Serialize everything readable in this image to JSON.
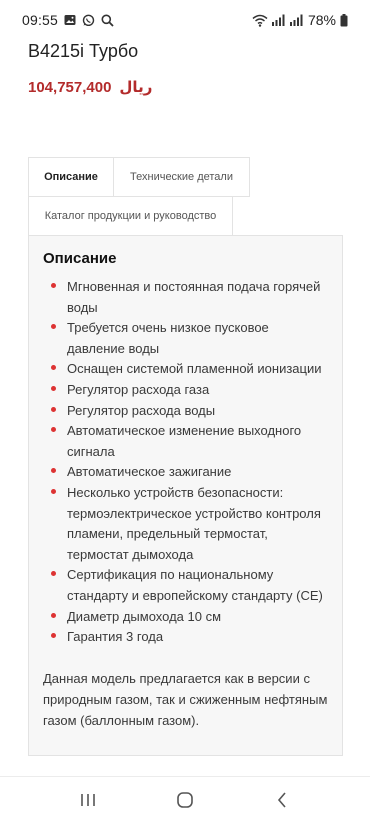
{
  "status_bar": {
    "time": "09:55",
    "battery": "78%",
    "icons": [
      "image-icon",
      "whatsapp-icon",
      "search-icon",
      "wifi-icon",
      "signal-icon",
      "signal-icon",
      "battery-icon"
    ]
  },
  "product": {
    "title": "B4215i Турбо",
    "price": "104,757,400",
    "currency": "ریال"
  },
  "tabs": [
    {
      "label": "Описание",
      "active": true
    },
    {
      "label": "Технические детали",
      "active": false
    },
    {
      "label": "Каталог продукции и руководство",
      "active": false
    }
  ],
  "description": {
    "heading": "Описание",
    "items": [
      "Мгновенная и постоянная подача горячей воды",
      "Требуется очень низкое пусковое давление воды",
      "Оснащен системой пламенной ионизации",
      "Регулятор расхода газа",
      "Регулятор расхода воды",
      "Автоматическое изменение выходного сигнала",
      "Автоматическое зажигание",
      "Несколько устройств безопасности: термоэлектрическое устройство контроля пламени, предельный термостат, термостат дымохода",
      "Сертификация по национальному стандарту и европейскому стандарту (CE)",
      "Диаметр дымохода 10 см",
      "Гарантия 3 года"
    ],
    "note": "Данная модель предлагается как в версии с природным газом, так и сжиженным нефтяным газом (баллонным газом)."
  },
  "colors": {
    "price": "#b32b2b",
    "bullet": "#dd3333"
  }
}
